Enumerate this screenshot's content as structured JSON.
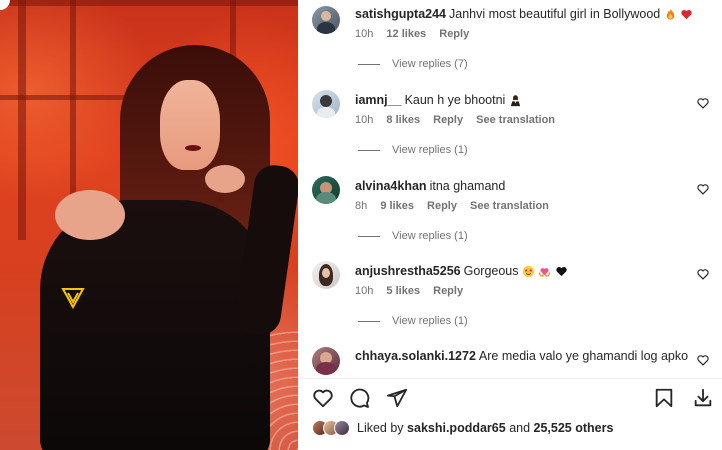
{
  "post": {
    "media": {
      "watermark_icon": "v-logo-icon"
    }
  },
  "comments": [
    {
      "username": "satishgupta244",
      "text": "Janhvi most beautiful girl in Bollywood",
      "emojis": [
        "fire",
        "red-heart"
      ],
      "time": "10h",
      "likes": "12 likes",
      "reply": "Reply",
      "see_translation": "",
      "view_replies": "View replies (7)"
    },
    {
      "username": "iamnj__",
      "text": "Kaun h ye bhootni",
      "emojis": [
        "woman-in-tuxedo"
      ],
      "time": "10h",
      "likes": "8 likes",
      "reply": "Reply",
      "see_translation": "See translation",
      "view_replies": "View replies (1)"
    },
    {
      "username": "alvina4khan",
      "text": "itna ghamand",
      "emojis": [],
      "time": "8h",
      "likes": "9 likes",
      "reply": "Reply",
      "see_translation": "See translation",
      "view_replies": "View replies (1)"
    },
    {
      "username": "anjushrestha5256",
      "text": "Gorgeous",
      "emojis": [
        "star-struck",
        "heart-hands",
        "black-heart"
      ],
      "time": "10h",
      "likes": "5 likes",
      "reply": "Reply",
      "see_translation": "",
      "view_replies": "View replies (1)"
    },
    {
      "username": "chhaya.solanki.1272",
      "text": "Are media valo ye ghamandi log apko",
      "emojis": [],
      "time": "",
      "likes": "",
      "reply": "",
      "see_translation": "",
      "view_replies": ""
    }
  ],
  "actions": {
    "like_icon": "heart-icon",
    "comment_icon": "comment-icon",
    "share_icon": "send-icon",
    "save_icon": "bookmark-icon",
    "download_icon": "download-icon"
  },
  "likes_summary": {
    "prefix": "Liked by",
    "user": "sakshi.poddar65",
    "conjunction": "and",
    "others": "25,525 others"
  },
  "colors": {
    "accent_text": "#262626",
    "meta_text": "#737373",
    "media_red": "#d7401f"
  }
}
